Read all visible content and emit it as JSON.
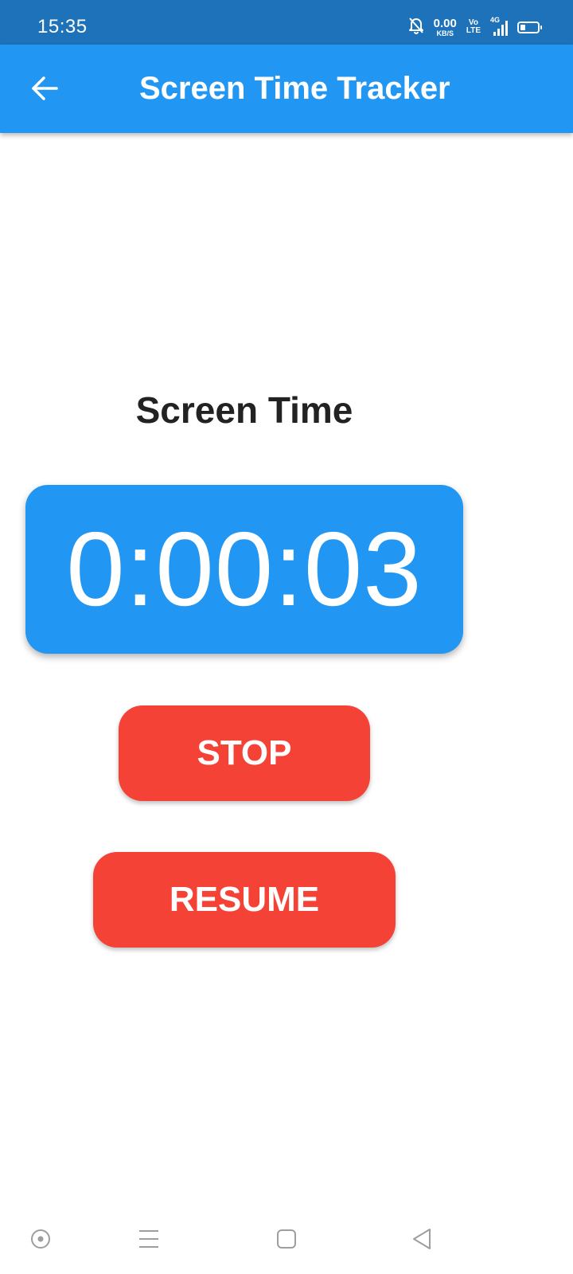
{
  "status_bar": {
    "time": "15:35",
    "net_speed_value": "0.00",
    "net_speed_unit": "KB/S",
    "volte_top": "Vo",
    "volte_bottom": "LTE",
    "network_type": "4G",
    "battery_level": 0.3,
    "icons": [
      "bell-muted-icon",
      "signal-icon",
      "battery-icon"
    ]
  },
  "app_bar": {
    "title": "Screen Time Tracker",
    "back_icon": "arrow-left-icon"
  },
  "main": {
    "heading": "Screen Time",
    "timer": "0:00:03",
    "stop_label": "STOP",
    "resume_label": "RESUME"
  },
  "nav_bar": {
    "items": [
      "assistant-icon",
      "menu-icon",
      "home-icon",
      "back-icon"
    ]
  },
  "colors": {
    "status_bar": "#1d72ba",
    "primary": "#2196f3",
    "button": "#f44336",
    "heading_text": "#222222"
  }
}
